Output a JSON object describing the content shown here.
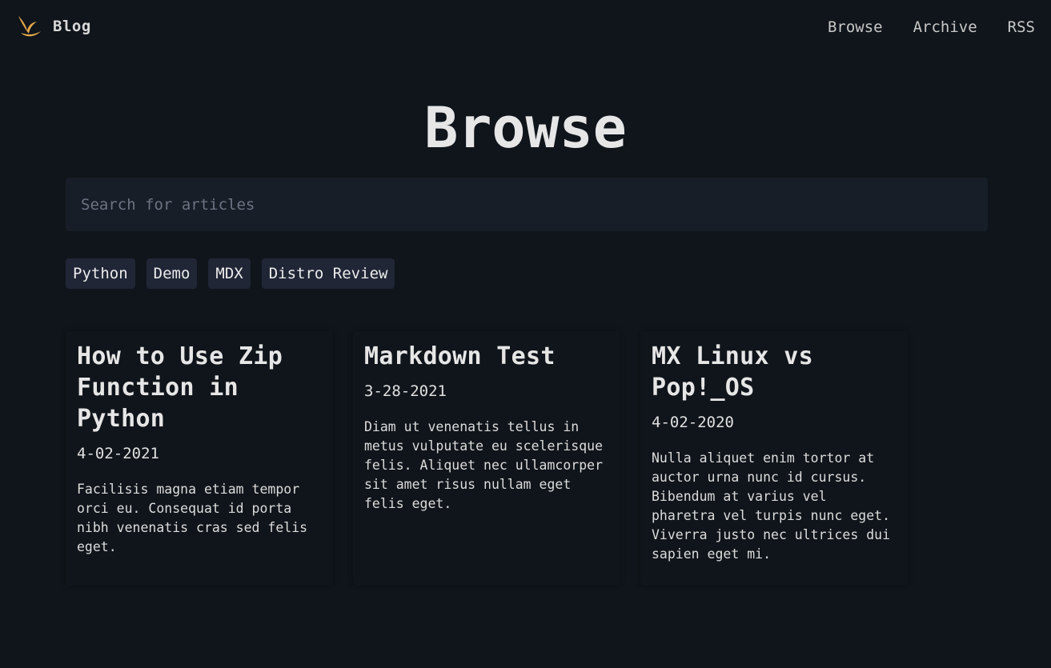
{
  "header": {
    "brand_label": "Blog",
    "brand_icon": "bird-logo-icon",
    "brand_color": "#e3a94a",
    "nav": [
      {
        "label": "Browse"
      },
      {
        "label": "Archive"
      },
      {
        "label": "RSS"
      }
    ]
  },
  "main": {
    "title": "Browse",
    "search": {
      "placeholder": "Search for articles",
      "value": ""
    },
    "tags": [
      {
        "label": "Python"
      },
      {
        "label": "Demo"
      },
      {
        "label": "MDX"
      },
      {
        "label": "Distro Review"
      }
    ],
    "articles": [
      {
        "title": "How to Use Zip Function in Python",
        "date": "4-02-2021",
        "excerpt": "Facilisis magna etiam tempor orci eu. Consequat id porta nibh venenatis cras sed felis eget."
      },
      {
        "title": "Markdown Test",
        "date": "3-28-2021",
        "excerpt": "Diam ut venenatis tellus in metus vulputate eu scelerisque felis. Aliquet nec ullamcorper sit amet risus nullam eget felis eget."
      },
      {
        "title": "MX Linux vs Pop!_OS",
        "date": "4-02-2020",
        "excerpt": "Nulla aliquet enim tortor at auctor urna nunc id cursus. Bibendum at varius vel pharetra vel turpis nunc eget. Viverra justo nec ultrices dui sapien eget mi."
      }
    ]
  }
}
